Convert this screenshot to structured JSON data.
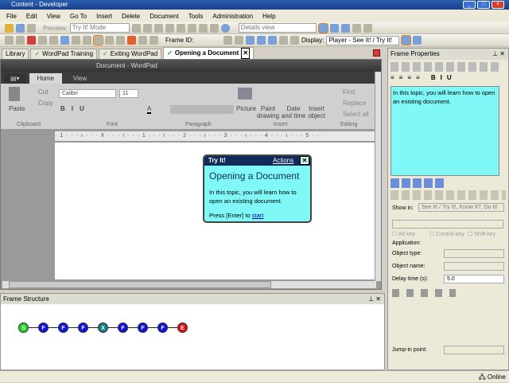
{
  "window": {
    "title": "Content - Developer"
  },
  "menu": [
    "File",
    "Edit",
    "View",
    "Go To",
    "Insert",
    "Delete",
    "Document",
    "Tools",
    "Administration",
    "Help"
  ],
  "toolbar1": {
    "preview_label": "Preview:",
    "preview_mode": "Try It! Mode",
    "view_select": "Details view"
  },
  "toolbar2": {
    "frame_id_label": "Frame ID:",
    "display_label": "Display:",
    "display_value": "Player - See It! / Try It!"
  },
  "tabs": [
    {
      "label": "Library"
    },
    {
      "label": "WordPad Training"
    },
    {
      "label": "Exiting WordPad"
    },
    {
      "label": "Opening a Document",
      "active": true
    }
  ],
  "wordpad": {
    "title": "Document - WordPad",
    "ribbon_tabs": [
      "Home",
      "View"
    ],
    "font": "Calibri",
    "size": "11",
    "buttons": {
      "paste": "Paste",
      "cut": "Cut",
      "copy": "Copy",
      "picture": "Picture",
      "paint": "Paint drawing",
      "datetime": "Date and time",
      "insert_object": "Insert object",
      "find": "Find",
      "replace": "Replace",
      "select_all": "Select all"
    },
    "groups": [
      "Clipboard",
      "Font",
      "Paragraph",
      "Insert",
      "Editing"
    ],
    "ruler": "· 1 · · · ı · · · X · · · ı · · · 1 · · · ı · · · 2 · · · ı · · · 3 · · · ı · · · 4 · · · ı · · · 5 · · ·"
  },
  "bubble": {
    "header": "Try It!",
    "actions": "Actions",
    "title": "Opening a Document",
    "body": "In this topic, you will learn how to open an existing document.",
    "next": "Press [Enter] to",
    "link": "start"
  },
  "frame_structure": {
    "title": "Frame Structure",
    "nodes": [
      {
        "l": "S",
        "c": "#20d020"
      },
      {
        "l": "F",
        "c": "#1010e0"
      },
      {
        "l": "F",
        "c": "#1010e0"
      },
      {
        "l": "F",
        "c": "#1010e0"
      },
      {
        "l": "X",
        "c": "#108080"
      },
      {
        "l": "F",
        "c": "#1010e0"
      },
      {
        "l": "F",
        "c": "#1010e0"
      },
      {
        "l": "F",
        "c": "#1010e0"
      },
      {
        "l": "E",
        "c": "#e01010"
      }
    ]
  },
  "properties": {
    "title": "Frame Properties",
    "text": "In this topic, you will learn how to open an existing document.",
    "show_in_label": "Show in:",
    "show_in_value": "See It! / Try It!, Know It?, Do It!",
    "alt": "Alt key",
    "ctrl": "Control key",
    "shift": "Shift key",
    "application": "Application:",
    "object_type": "Object type:",
    "object_name": "Object name:",
    "delay_label": "Delay time (s):",
    "delay_value": "5.0",
    "jump_in": "Jump-in point:"
  },
  "status": "Online"
}
